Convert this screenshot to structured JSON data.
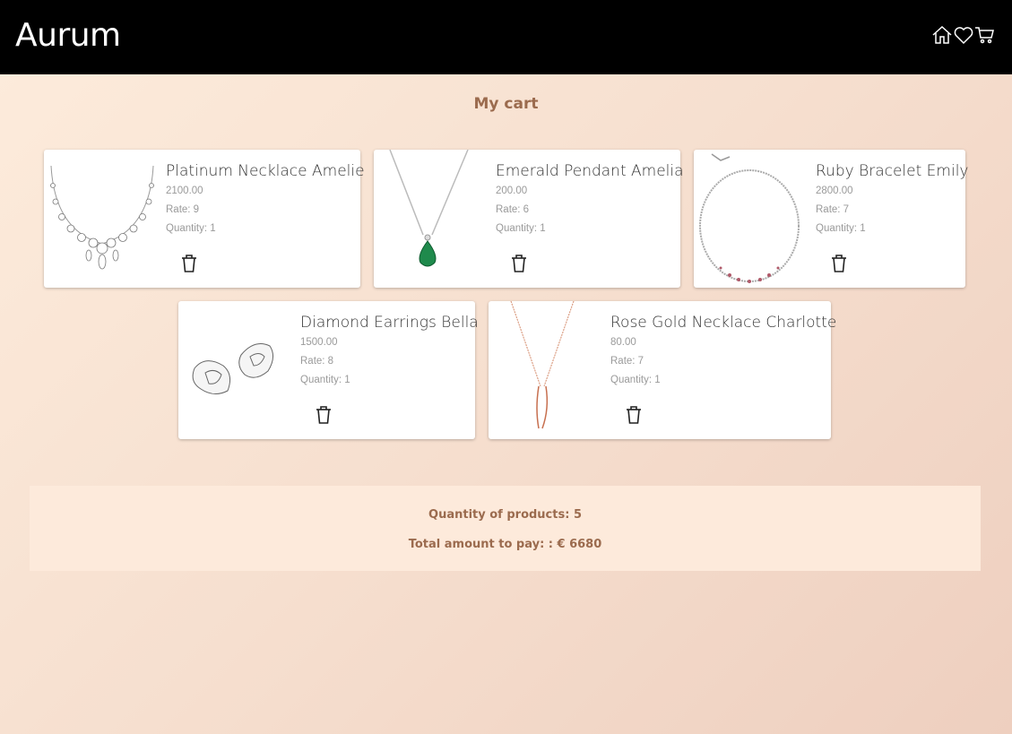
{
  "header": {
    "brand": "Aurum",
    "icons": [
      "home-icon",
      "heart-icon",
      "cart-icon"
    ]
  },
  "page": {
    "title": "My cart"
  },
  "cart": {
    "items": [
      {
        "name": "Platinum Necklace Amelie",
        "price": "2100.00",
        "rate": "Rate: 9",
        "quantity": "Quantity: 1",
        "image": "diamond-necklace-image"
      },
      {
        "name": "Emerald Pendant Amelia",
        "price": "200.00",
        "rate": "Rate: 6",
        "quantity": "Quantity: 1",
        "image": "emerald-pendant-image"
      },
      {
        "name": "Ruby Bracelet Emily",
        "price": "2800.00",
        "rate": "Rate: 7",
        "quantity": "Quantity: 1",
        "image": "ruby-bracelet-image"
      },
      {
        "name": "Diamond Earrings Bella",
        "price": "1500.00",
        "rate": "Rate: 8",
        "quantity": "Quantity: 1",
        "image": "diamond-earrings-image"
      },
      {
        "name": "Rose Gold Necklace Charlotte",
        "price": "80.00",
        "rate": "Rate: 7",
        "quantity": "Quantity: 1",
        "image": "rose-gold-necklace-image"
      }
    ]
  },
  "summary": {
    "quantity_text": "Quantity of products: 5",
    "total_text": "Total amount to pay: : € 6680"
  },
  "colors": {
    "accent": "#9b6b4e",
    "header_bg": "#000000",
    "summary_bg": "#fdeadb"
  }
}
